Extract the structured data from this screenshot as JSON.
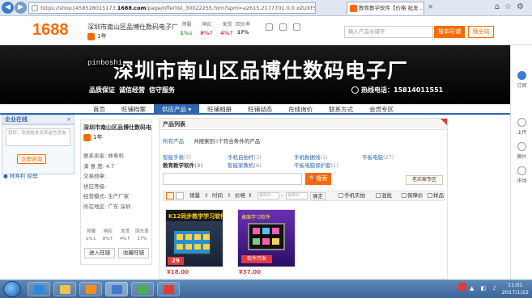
{
  "browser": {
    "url_prefix": "https://shop1458528015173.",
    "url_domain": "1688.com",
    "url_suffix": "/page/offerlist_30022255.htm?spm=a2615.2177701.0.0.xZUXFS",
    "tab_title": "教育教学软件【价格 批发 …",
    "close": "×"
  },
  "header": {
    "logo": "1688",
    "shop_name": "深圳市南山区品博仕数码电子厂",
    "year": "1年",
    "stats": [
      {
        "label": "师服",
        "value": "1%↓",
        "color": "g"
      },
      {
        "label": "响应",
        "value": "8%↑",
        "color": "r"
      },
      {
        "label": "发货",
        "value": "4%↑",
        "color": "r"
      }
    ],
    "repeat_label": "回头率",
    "repeat_value": "17%",
    "search_placeholder": "输入产品关键字",
    "search_shop_btn": "搜本旺铺",
    "search_all_btn": "搜全站"
  },
  "banner": {
    "title": "深圳市南山区品博仕数码电子厂",
    "watermark": "pinboshi",
    "slogans": [
      "品质保证",
      "诚信经营",
      "信守服务"
    ],
    "hotline_label": "热线电话：",
    "hotline_number": "15814011551"
  },
  "menu": [
    "首页",
    "旺铺档案",
    "供应产品 ▾",
    "旺铺相册",
    "旺铺动态",
    "在线询价",
    "联系方式",
    "会员专区"
  ],
  "online": {
    "title": "企业在线",
    "close": "×",
    "placeholder": "您好，欢迎给本买卖留言咨询",
    "button": "立即咨询",
    "footer": "林寿利 经理"
  },
  "shopcard": {
    "title": "深圳市南山区品博仕数码电...",
    "year": "1年",
    "lines": [
      "联系卖家: 林寿利",
      "满 意 度: 4.7",
      "交易勋章:",
      "供应等级:",
      "经营模式: 生产厂家",
      "所在地区: 广东 深圳"
    ],
    "stats": [
      {
        "label": "师服",
        "value": "1%↓",
        "color": "g"
      },
      {
        "label": "响应",
        "value": "8%↑",
        "color": "r"
      },
      {
        "label": "发货",
        "value": "4%↑",
        "color": "r"
      },
      {
        "label": "回头率",
        "value": "17%",
        "color": ""
      }
    ],
    "btn_enter": "进入旺铺",
    "btn_fav": "收藏旺铺"
  },
  "content": {
    "title": "产品列表",
    "all_products": "所有产品",
    "found_prefix": "共搜索到",
    "found_count": "3",
    "found_suffix": "个符合条件的产品",
    "categories": [
      {
        "name": "智能手表",
        "count": "(7)",
        "bold": false
      },
      {
        "name": "手机自拍杆",
        "count": "(3)",
        "bold": false
      },
      {
        "name": "手机数据线",
        "count": "(1)",
        "bold": false
      },
      {
        "name": "平板电脑",
        "count": "(27)",
        "bold": false
      },
      {
        "name": "教育教学软件",
        "count": "(3)",
        "bold": true
      },
      {
        "name": "智能家教机",
        "count": "(6)",
        "bold": false
      },
      {
        "name": "平板电脑保护套",
        "count": "(1)",
        "bold": false
      }
    ],
    "search_btn": "搜索",
    "old_buyer": "老买家专区",
    "sort": {
      "sales": "销量",
      "time": "时间",
      "price": "价格",
      "min": "最低价",
      "max": "最高价",
      "sep": "-",
      "ok": "确定"
    },
    "filters": [
      "手机实拍",
      "混批",
      "保障价",
      "样品"
    ],
    "products": [
      {
        "caption": "K12同步教学学习软件",
        "badge": "29",
        "price": "¥18.00"
      },
      {
        "caption": "桌面学习软件",
        "badge": "软件开发",
        "price": "¥37.00"
      }
    ]
  },
  "rightbar": [
    "订阅",
    "上传",
    "图片",
    "市场"
  ],
  "taskbar": {
    "time": "11:01",
    "date": "2017/1/22"
  },
  "colors": {
    "brand": "#ff6a00",
    "nav": "#2f66b0"
  }
}
